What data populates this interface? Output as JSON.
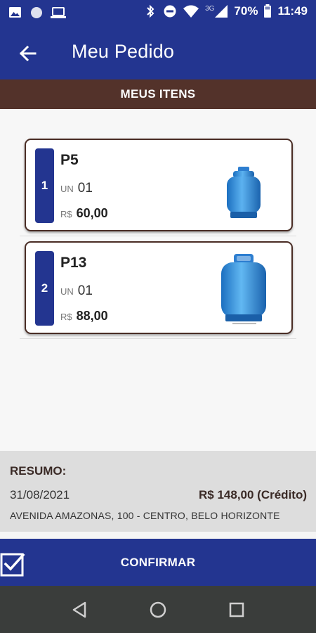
{
  "status_bar": {
    "battery": "70%",
    "time": "11:49",
    "network": "3G",
    "icons": [
      "image-icon",
      "circle-icon",
      "laptop-icon",
      "bluetooth-icon",
      "do-not-disturb-icon",
      "wifi-icon",
      "signal-icon",
      "battery-icon"
    ]
  },
  "app_bar": {
    "title": "Meu Pedido",
    "back_icon": "arrow-left-icon"
  },
  "section": {
    "title": "MEUS ITENS"
  },
  "items": [
    {
      "index": "1",
      "name": "P5",
      "unit_label": "UN",
      "unit_value": "01",
      "currency": "R$",
      "price": "60,00",
      "image": "gas-cylinder-small"
    },
    {
      "index": "2",
      "name": "P13",
      "unit_label": "UN",
      "unit_value": "01",
      "currency": "R$",
      "price": "88,00",
      "image": "gas-cylinder-large"
    }
  ],
  "summary": {
    "title": "RESUMO:",
    "date": "31/08/2021",
    "total": "R$ 148,00 (Crédito)",
    "address": "AVENIDA AMAZONAS, 100 - CENTRO, BELO HORIZONTE"
  },
  "confirm": {
    "label": "CONFIRMAR",
    "icon": "checkbox-checked-icon"
  },
  "nav": {
    "icons": [
      "back-triangle-icon",
      "home-circle-icon",
      "recents-square-icon"
    ]
  },
  "colors": {
    "primary": "#233590",
    "brown": "#53322a",
    "summary_bg": "#dddddd",
    "cylinder_blue": "#2f8fe0"
  }
}
